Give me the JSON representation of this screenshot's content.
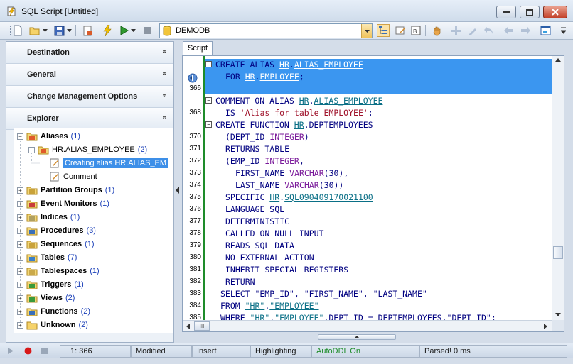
{
  "window": {
    "title": "SQL Script [Untitled]",
    "buttons": {
      "minimize": "minimize",
      "maximize": "maximize",
      "close": "close"
    }
  },
  "toolbar": {
    "database": "DEMODB"
  },
  "left_panel": {
    "sections": [
      {
        "label": "Destination",
        "chevron": "»"
      },
      {
        "label": "General",
        "chevron": "»"
      },
      {
        "label": "Change Management Options",
        "chevron": "»"
      },
      {
        "label": "Explorer",
        "chevron": "«"
      }
    ],
    "tree": [
      {
        "label": "Aliases",
        "count": "(1)",
        "expander": "−",
        "icon": "aliases-icon"
      },
      {
        "label": "HR.ALIAS_EMPLOYEE",
        "count": "(2)",
        "expander": "−",
        "icon": "alias-icon"
      },
      {
        "label": "Creating alias HR.ALIAS_EM",
        "count": "",
        "expander": "",
        "icon": "script-icon"
      },
      {
        "label": "Comment",
        "count": "",
        "expander": "",
        "icon": "script-icon"
      },
      {
        "label": "Partition Groups",
        "count": "(1)",
        "expander": "+",
        "icon": "partition-groups-icon"
      },
      {
        "label": "Event Monitors",
        "count": "(1)",
        "expander": "+",
        "icon": "event-monitors-icon"
      },
      {
        "label": "Indices",
        "count": "(1)",
        "expander": "+",
        "icon": "indices-icon"
      },
      {
        "label": "Procedures",
        "count": "(3)",
        "expander": "+",
        "icon": "procedures-icon"
      },
      {
        "label": "Sequences",
        "count": "(1)",
        "expander": "+",
        "icon": "sequences-icon"
      },
      {
        "label": "Tables",
        "count": "(7)",
        "expander": "+",
        "icon": "tables-icon"
      },
      {
        "label": "Tablespaces",
        "count": "(1)",
        "expander": "+",
        "icon": "tablespaces-icon"
      },
      {
        "label": "Triggers",
        "count": "(1)",
        "expander": "+",
        "icon": "triggers-icon"
      },
      {
        "label": "Views",
        "count": "(2)",
        "expander": "+",
        "icon": "views-icon"
      },
      {
        "label": "Functions",
        "count": "(2)",
        "expander": "+",
        "icon": "functions-icon"
      },
      {
        "label": "Unknown",
        "count": "(2)",
        "expander": "+",
        "icon": "folder-icon"
      }
    ]
  },
  "editor": {
    "tab": "Script",
    "lines": [
      {
        "num": "",
        "fold": "−",
        "indent": 0,
        "parts": [
          [
            "kw",
            "CREATE ALIAS "
          ],
          [
            "ref",
            "HR"
          ],
          [
            "kw",
            "."
          ],
          [
            "ref",
            "ALIAS_EMPLOYEE"
          ]
        ]
      },
      {
        "num": "",
        "fold": "",
        "indent": 2,
        "parts": [
          [
            "kw",
            "FOR "
          ],
          [
            "ref",
            "HR"
          ],
          [
            "kw",
            "."
          ],
          [
            "ref",
            "EMPLOYEE"
          ],
          [
            "kw",
            ";"
          ]
        ]
      },
      {
        "num": "366",
        "fold": "",
        "indent": 0,
        "parts": []
      },
      {
        "num": "",
        "fold": "−",
        "indent": 0,
        "parts": [
          [
            "kw",
            "COMMENT ON ALIAS "
          ],
          [
            "ref",
            "HR"
          ],
          [
            "kw",
            "."
          ],
          [
            "ref",
            "ALIAS_EMPLOYEE"
          ]
        ]
      },
      {
        "num": "368",
        "fold": "",
        "indent": 2,
        "parts": [
          [
            "kw",
            "IS "
          ],
          [
            "str",
            "'Alias for table EMPLOYEE'"
          ],
          [
            "kw",
            ";"
          ]
        ]
      },
      {
        "num": "",
        "fold": "−",
        "indent": 0,
        "parts": [
          [
            "kw",
            "CREATE FUNCTION "
          ],
          [
            "ref",
            "HR"
          ],
          [
            "kw",
            ".DEPTEMPLOYEES"
          ]
        ]
      },
      {
        "num": "370",
        "fold": "",
        "indent": 2,
        "parts": [
          [
            "kw",
            "(DEPT_ID "
          ],
          [
            "typ",
            "INTEGER"
          ],
          [
            "kw",
            ")"
          ]
        ]
      },
      {
        "num": "371",
        "fold": "",
        "indent": 2,
        "parts": [
          [
            "kw",
            "RETURNS TABLE"
          ]
        ]
      },
      {
        "num": "372",
        "fold": "",
        "indent": 2,
        "parts": [
          [
            "kw",
            "(EMP_ID "
          ],
          [
            "typ",
            "INTEGER"
          ],
          [
            "kw",
            ","
          ]
        ]
      },
      {
        "num": "373",
        "fold": "",
        "indent": 4,
        "parts": [
          [
            "kw",
            "FIRST_NAME "
          ],
          [
            "typ",
            "VARCHAR"
          ],
          [
            "kw",
            "(30),"
          ]
        ]
      },
      {
        "num": "374",
        "fold": "",
        "indent": 4,
        "parts": [
          [
            "kw",
            "LAST_NAME "
          ],
          [
            "typ",
            "VARCHAR"
          ],
          [
            "kw",
            "(30))"
          ]
        ]
      },
      {
        "num": "375",
        "fold": "",
        "indent": 2,
        "parts": [
          [
            "kw",
            "SPECIFIC "
          ],
          [
            "ref",
            "HR"
          ],
          [
            "kw",
            "."
          ],
          [
            "ref",
            "SQL090409170021100"
          ]
        ]
      },
      {
        "num": "376",
        "fold": "",
        "indent": 2,
        "parts": [
          [
            "kw",
            "LANGUAGE SQL"
          ]
        ]
      },
      {
        "num": "377",
        "fold": "",
        "indent": 2,
        "parts": [
          [
            "kw",
            "DETERMINISTIC"
          ]
        ]
      },
      {
        "num": "378",
        "fold": "",
        "indent": 2,
        "parts": [
          [
            "kw",
            "CALLED ON NULL INPUT"
          ]
        ]
      },
      {
        "num": "379",
        "fold": "",
        "indent": 2,
        "parts": [
          [
            "kw",
            "READS SQL DATA"
          ]
        ]
      },
      {
        "num": "380",
        "fold": "",
        "indent": 2,
        "parts": [
          [
            "kw",
            "NO EXTERNAL ACTION"
          ]
        ]
      },
      {
        "num": "381",
        "fold": "",
        "indent": 2,
        "parts": [
          [
            "kw",
            "INHERIT SPECIAL REGISTERS"
          ]
        ]
      },
      {
        "num": "382",
        "fold": "",
        "indent": 2,
        "parts": [
          [
            "kw",
            "RETURN"
          ]
        ]
      },
      {
        "num": "383",
        "fold": "",
        "indent": 1,
        "parts": [
          [
            "kw",
            "SELECT \"EMP_ID\", \"FIRST_NAME\", \"LAST_NAME\""
          ]
        ]
      },
      {
        "num": "384",
        "fold": "",
        "indent": 1,
        "parts": [
          [
            "kw",
            "FROM "
          ],
          [
            "ref",
            "\"HR\""
          ],
          [
            "kw",
            "."
          ],
          [
            "ref",
            "\"EMPLOYEE\""
          ]
        ]
      },
      {
        "num": "385",
        "fold": "",
        "indent": 1,
        "parts": [
          [
            "kw",
            "WHERE "
          ],
          [
            "ref",
            "\"HR\""
          ],
          [
            "kw",
            "."
          ],
          [
            "ref",
            "\"EMPLOYEE\""
          ],
          [
            "kw",
            ".DEPT_ID = DEPTEMPLOYEES.\"DEPT_ID\";"
          ]
        ]
      }
    ],
    "hscroll_grip": "III"
  },
  "statusbar": {
    "position": "1:   366",
    "modified": "Modified",
    "insert": "Insert",
    "highlighting": "Highlighting",
    "autoddl": "AutoDDL On",
    "parsed": "Parsed! 0 ms"
  },
  "colors": {
    "selection": "#3b96f0",
    "keyword": "#000080",
    "reference": "#0a6f86",
    "string": "#a0142c",
    "type": "#7a1a9a",
    "autoddl": "#1e8c2a"
  }
}
